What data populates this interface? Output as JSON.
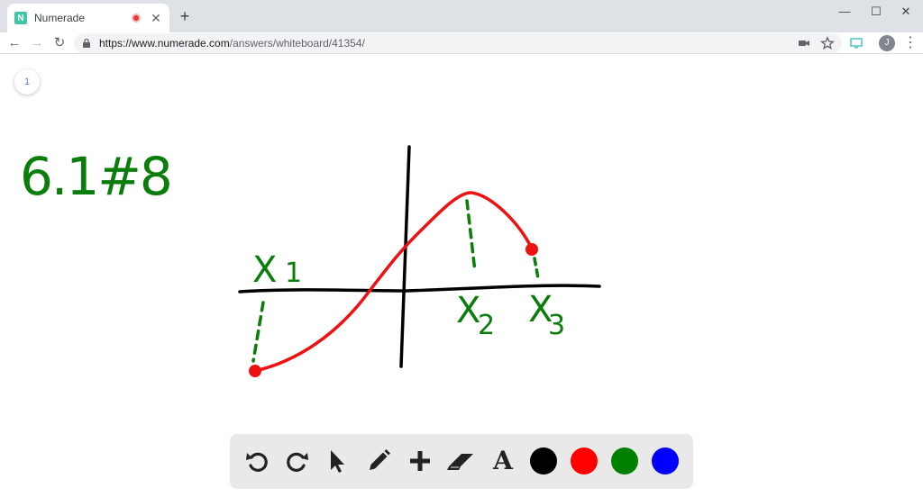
{
  "browser": {
    "tab_title": "Numerade",
    "favicon_letter": "N",
    "tab_close": "✕",
    "new_tab": "+",
    "url_host": "https://www.numerade.com",
    "url_path": "/answers/whiteboard/41354/",
    "profile_initial": "J",
    "window_controls": {
      "minimize": "—",
      "maximize": "☐",
      "close": "✕"
    },
    "nav": {
      "back": "←",
      "forward": "→",
      "reload": "↻"
    },
    "kebab": "⋮"
  },
  "whiteboard": {
    "page_number": "1",
    "handwritten": {
      "problem_label": "6.1#8",
      "x1_label": "X",
      "x1_sub": "1",
      "x2_label": "X",
      "x2_sub": "2",
      "x3_label": "X",
      "x3_sub": "3"
    },
    "colors": {
      "ink_black": "#000000",
      "ink_red": "#ee1111",
      "ink_green": "#0a7d0a"
    }
  },
  "palette": {
    "tools": [
      "undo-icon",
      "redo-icon",
      "pointer-icon",
      "pencil-icon",
      "plus-icon",
      "eraser-icon",
      "text-icon"
    ],
    "text_tool_glyph": "A",
    "swatches": [
      {
        "name": "black",
        "color": "#000000"
      },
      {
        "name": "red",
        "color": "#ff0000"
      },
      {
        "name": "green",
        "color": "#008000"
      },
      {
        "name": "blue",
        "color": "#0000ff"
      }
    ]
  }
}
